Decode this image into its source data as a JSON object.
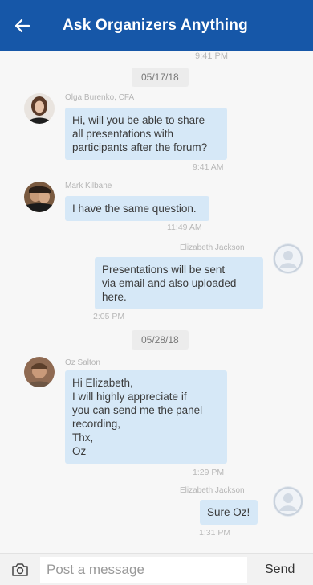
{
  "header": {
    "title": "Ask Organizers Anything",
    "back_icon": "arrow-left-icon"
  },
  "chat": {
    "previous_time": "9:41 PM",
    "dates": [
      "05/17/18",
      "05/28/18"
    ],
    "messages": [
      {
        "sender": "Olga Burenko, CFA",
        "text": "Hi, will you be able to share\nall presentations with\nparticipants after the forum?",
        "time": "9:41 AM",
        "side": "left"
      },
      {
        "sender": "Mark Kilbane",
        "text": "I have the same question.",
        "time": "11:49 AM",
        "side": "left"
      },
      {
        "sender": "Elizabeth Jackson",
        "text": "Presentations will be sent\nvia email and also uploaded\nhere.",
        "time": "2:05 PM",
        "side": "right"
      },
      {
        "sender": "Oz Salton",
        "text": "Hi Elizabeth,\nI will highly appreciate if\nyou can send me the panel\nrecording,\nThx,\nOz",
        "time": "1:29 PM",
        "side": "left"
      },
      {
        "sender": "Elizabeth Jackson",
        "text": "Sure Oz!",
        "time": "1:31 PM",
        "side": "right"
      }
    ]
  },
  "composer": {
    "placeholder": "Post a message",
    "send_label": "Send",
    "camera_icon": "camera-icon"
  },
  "colors": {
    "header_bg": "#1657a8",
    "bubble_bg": "#d6e8f7"
  }
}
